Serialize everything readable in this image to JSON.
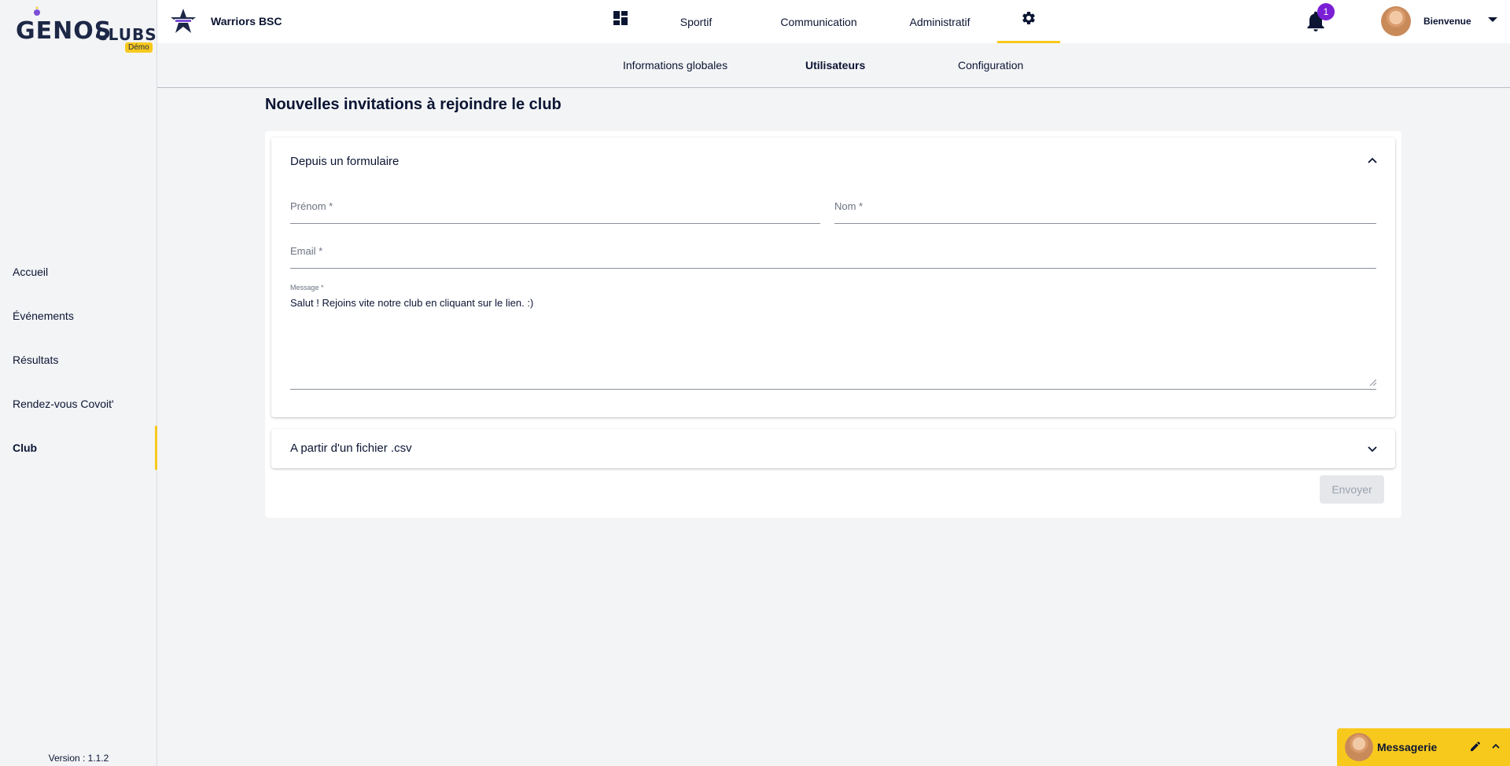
{
  "sidebar": {
    "logo_main": "GENOS",
    "logo_sub": "CLUBS",
    "logo_badge": "Démo",
    "items": [
      {
        "label": "Accueil"
      },
      {
        "label": "Événements"
      },
      {
        "label": "Résultats"
      },
      {
        "label": "Rendez-vous Covoit'"
      },
      {
        "label": "Club"
      }
    ],
    "active_item": "Club",
    "version": "Version : 1.1.2"
  },
  "topbar": {
    "club_name": "Warriors BSC",
    "tabs": [
      {
        "label": "",
        "icon": "dashboard-icon"
      },
      {
        "label": "Sportif"
      },
      {
        "label": "Communication"
      },
      {
        "label": "Administratif"
      },
      {
        "label": "",
        "icon": "gear-icon"
      }
    ],
    "notification_count": "1",
    "welcome": "Bienvenue"
  },
  "subnav": {
    "tabs": [
      {
        "label": "Informations globales"
      },
      {
        "label": "Utilisateurs"
      },
      {
        "label": "Configuration"
      }
    ],
    "active_tab": "Utilisateurs"
  },
  "main": {
    "title": "Nouvelles invitations à rejoindre le club",
    "form_section": {
      "title": "Depuis un formulaire",
      "expanded": true,
      "firstname_label": "Prénom *",
      "lastname_label": "Nom *",
      "email_label": "Email *",
      "message_label": "Message *",
      "message_value": "Salut ! Rejoins vite notre club en cliquant sur le lien. :)"
    },
    "csv_section": {
      "title": "A partir d'un fichier .csv",
      "expanded": false
    },
    "send_label": "Envoyer"
  },
  "messaging": {
    "title": "Messagerie"
  },
  "colors": {
    "accent": "#f8c91d",
    "badge": "#7b1fd6",
    "text": "#0b1533",
    "background": "#f3f4f6"
  }
}
